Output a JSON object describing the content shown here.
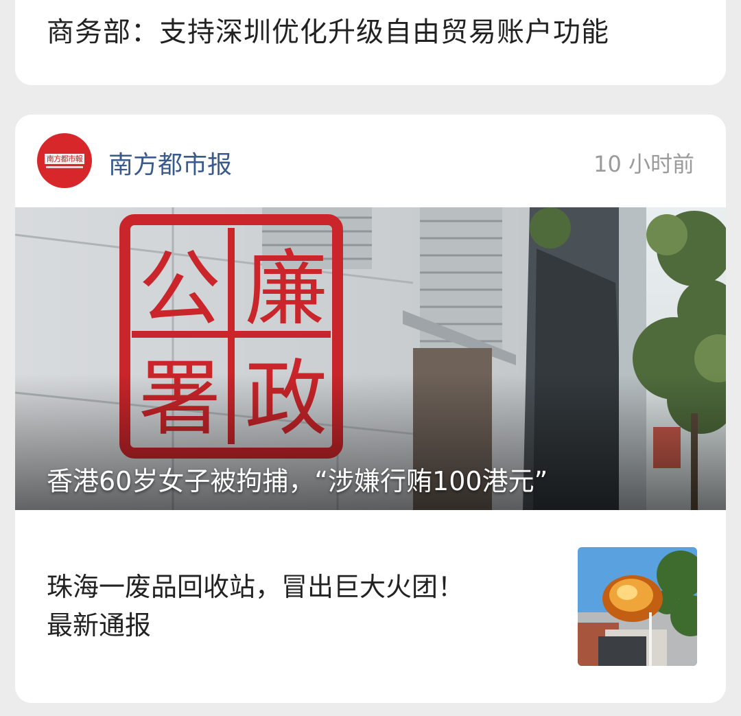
{
  "feed": {
    "top_card": {
      "headline": "商务部：支持深圳优化升级自由贸易账户功能"
    },
    "source_card": {
      "source": {
        "name": "南方都市报",
        "logo_text": "南方都市報",
        "time": "10 小时前"
      },
      "hero": {
        "title": "香港60岁女子被拘捕，“涉嫌行贿100港元”",
        "sign_characters": [
          "廉",
          "政",
          "公",
          "署"
        ],
        "sign_icon": "icac-seal-sign"
      },
      "item": {
        "title_line1": "珠海一废品回收站，冒出巨大火团！",
        "title_line2": "最新通报",
        "thumbnail_icon": "fireball-photo"
      }
    }
  },
  "colors": {
    "background": "#ececec",
    "card": "#ffffff",
    "source_name": "#3a5a8c",
    "logo_red": "#d7272a",
    "time_gray": "#9a9a9a"
  }
}
